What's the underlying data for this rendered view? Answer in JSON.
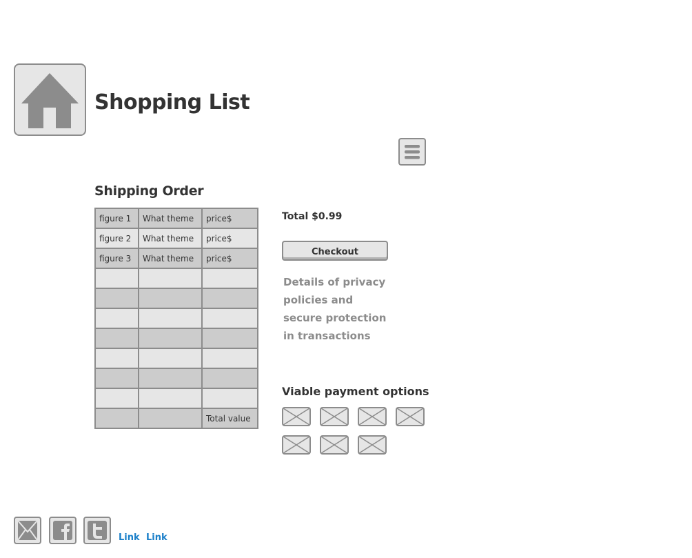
{
  "header": {
    "home_icon": "home-icon",
    "title": "Shopping List",
    "menu_icon": "hamburger-menu-icon"
  },
  "order": {
    "title": "Shipping Order",
    "rows": [
      [
        "figure 1",
        "What theme",
        "price$"
      ],
      [
        "figure 2",
        "What theme",
        "price$"
      ],
      [
        "figure 3",
        "What theme",
        "price$"
      ],
      [
        "",
        "",
        ""
      ],
      [
        "",
        "",
        ""
      ],
      [
        "",
        "",
        ""
      ],
      [
        "",
        "",
        ""
      ],
      [
        "",
        "",
        ""
      ],
      [
        "",
        "",
        ""
      ],
      [
        "",
        "",
        ""
      ],
      [
        "",
        "",
        "Total value"
      ]
    ]
  },
  "summary": {
    "total": "Total $0.99",
    "checkout_label": "Checkout",
    "privacy_text": "Details of privacy policies and secure protection in transactions"
  },
  "payment": {
    "title": "Viable payment options",
    "options": [
      "image-placeholder-icon",
      "image-placeholder-icon",
      "image-placeholder-icon",
      "image-placeholder-icon",
      "image-placeholder-icon",
      "image-placeholder-icon",
      "image-placeholder-icon"
    ]
  },
  "footer": {
    "icons": [
      "mail-icon",
      "facebook-icon",
      "twitter-icon"
    ],
    "links": [
      "Link",
      "Link"
    ]
  },
  "colors": {
    "border": "#8c8c8c",
    "fill_light": "#e6e6e6",
    "fill_dark": "#cccccc",
    "link": "#1a7fc9"
  }
}
